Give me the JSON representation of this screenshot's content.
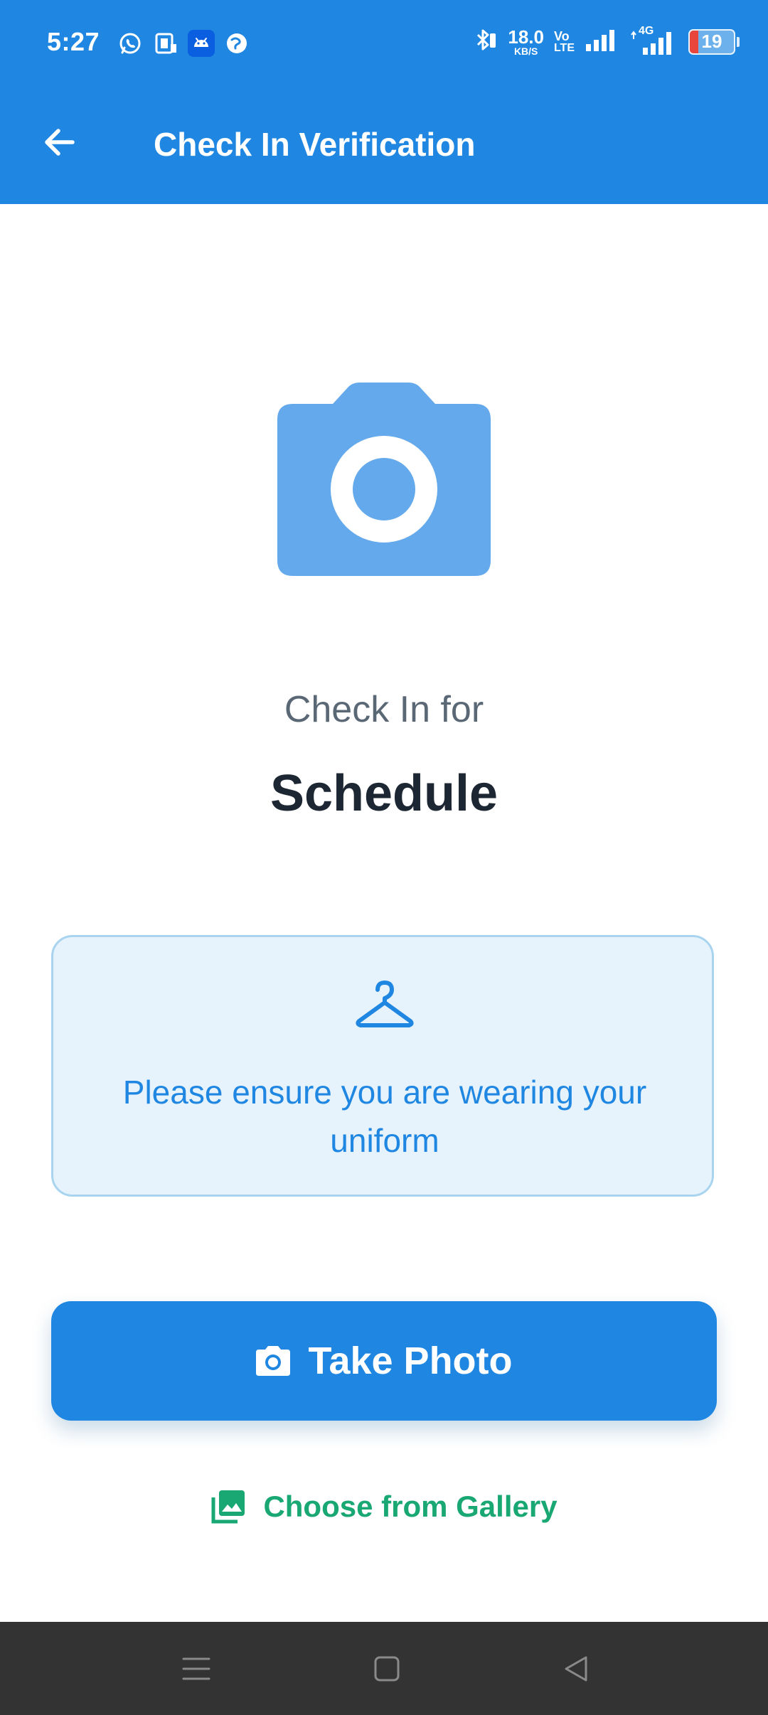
{
  "status_bar": {
    "time": "5:27",
    "network_speed_value": "18.0",
    "network_speed_unit": "KB/S",
    "volte_line1": "Vo",
    "volte_line2": "LTE",
    "network_type": "4G",
    "battery_level": "19",
    "battery_fraction": 0.19,
    "left_icons": [
      "whatsapp-icon",
      "phone-sim-icon",
      "android-icon",
      "browser-icon"
    ],
    "right_icons": [
      "bluetooth-icon",
      "signal-icon",
      "signal-4g-icon",
      "battery-icon"
    ]
  },
  "app_bar": {
    "title": "Check In Verification",
    "back_icon": "arrow-left-icon"
  },
  "hero": {
    "icon": "camera-icon",
    "color": "#64a9eb"
  },
  "checkin": {
    "label": "Check In for",
    "schedule": "Schedule"
  },
  "notice": {
    "icon": "hanger-icon",
    "text": "Please ensure you are wearing your uniform"
  },
  "actions": {
    "take_photo": "Take Photo",
    "take_photo_icon": "camera-icon",
    "gallery": "Choose from Gallery",
    "gallery_icon": "gallery-icon"
  },
  "nav_bar": {
    "items": [
      "menu-icon",
      "home-icon",
      "back-icon"
    ]
  },
  "colors": {
    "primary": "#1f87e2",
    "hero_icon": "#64a9eb",
    "notice_bg": "#e7f3fc",
    "notice_border": "#a9d4ef",
    "gallery_accent": "#19a773",
    "title_text": "#1d2733",
    "subtitle_text": "#5a6875",
    "navbar_bg": "#333333"
  }
}
